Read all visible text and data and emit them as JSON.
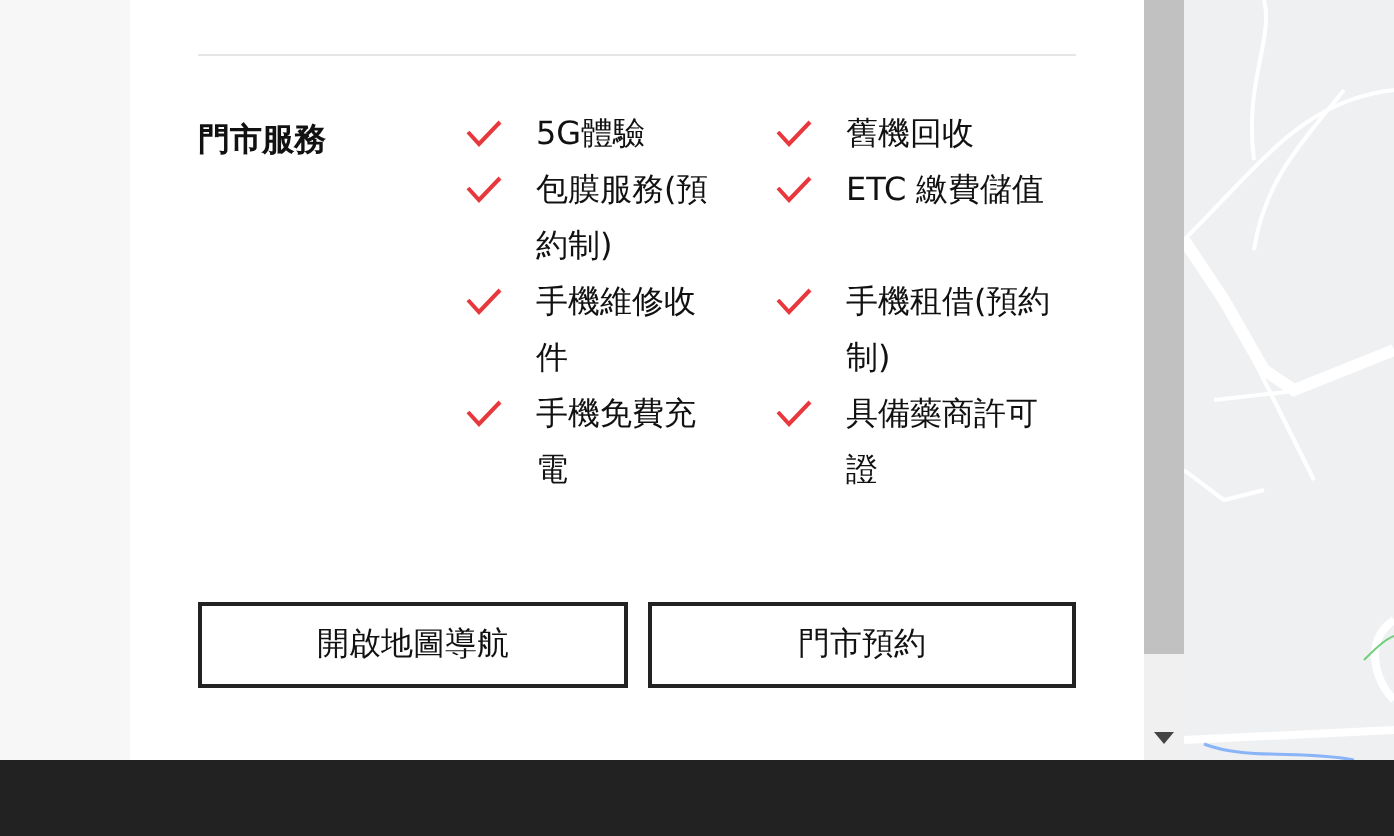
{
  "services": {
    "label": "門市服務",
    "items": [
      {
        "text": "5G體驗"
      },
      {
        "text": "舊機回收"
      },
      {
        "text": "包膜服務(預約制)"
      },
      {
        "text": "ETC 繳費儲值"
      },
      {
        "text": "手機維修收件"
      },
      {
        "text": "手機租借(預約制)"
      },
      {
        "text": "手機免費充電"
      },
      {
        "text": "具備藥商許可證"
      }
    ]
  },
  "buttons": [
    "開啟地圖導航",
    "門市預約"
  ]
}
